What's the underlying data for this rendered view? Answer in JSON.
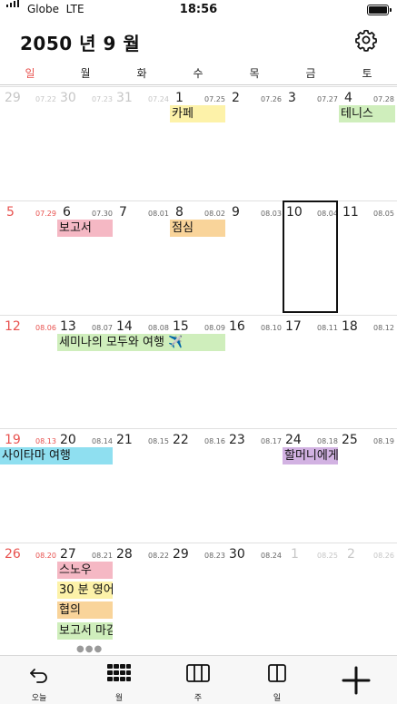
{
  "status_bar": {
    "carrier": "Globe",
    "network": "LTE",
    "time": "18:56"
  },
  "header": {
    "title": "2050 년 9 월"
  },
  "weekdays": [
    "일",
    "월",
    "화",
    "수",
    "목",
    "금",
    "토"
  ],
  "weeks": [
    {
      "days": [
        {
          "day": "29",
          "lunar": "07.22",
          "muted": true
        },
        {
          "day": "30",
          "lunar": "07.23",
          "muted": true
        },
        {
          "day": "31",
          "lunar": "07.24",
          "muted": true
        },
        {
          "day": "1",
          "lunar": "07.25"
        },
        {
          "day": "2",
          "lunar": "07.26"
        },
        {
          "day": "3",
          "lunar": "07.27"
        },
        {
          "day": "4",
          "lunar": "07.28"
        }
      ],
      "events": [
        {
          "title": "카페",
          "color": "#fdf2a9"
        },
        {
          "title": "테니스",
          "color": "#cfeebc"
        }
      ]
    },
    {
      "days": [
        {
          "day": "5",
          "lunar": "07.29"
        },
        {
          "day": "6",
          "lunar": "07.30"
        },
        {
          "day": "7",
          "lunar": "08.01"
        },
        {
          "day": "8",
          "lunar": "08.02"
        },
        {
          "day": "9",
          "lunar": "08.03"
        },
        {
          "day": "10",
          "lunar": "08.04",
          "today": true
        },
        {
          "day": "11",
          "lunar": "08.05"
        }
      ],
      "events": [
        {
          "title": "보고서",
          "color": "#f5b8c4"
        },
        {
          "title": "점심",
          "color": "#f9d49a"
        }
      ]
    },
    {
      "days": [
        {
          "day": "12",
          "lunar": "08.06"
        },
        {
          "day": "13",
          "lunar": "08.07"
        },
        {
          "day": "14",
          "lunar": "08.08"
        },
        {
          "day": "15",
          "lunar": "08.09"
        },
        {
          "day": "16",
          "lunar": "08.10"
        },
        {
          "day": "17",
          "lunar": "08.11"
        },
        {
          "day": "18",
          "lunar": "08.12"
        }
      ],
      "events": [
        {
          "title": "세미나의 모두와 여행 ✈️",
          "color": "#cfeebc"
        }
      ]
    },
    {
      "days": [
        {
          "day": "19",
          "lunar": "08.13"
        },
        {
          "day": "20",
          "lunar": "08.14"
        },
        {
          "day": "21",
          "lunar": "08.15"
        },
        {
          "day": "22",
          "lunar": "08.16"
        },
        {
          "day": "23",
          "lunar": "08.17"
        },
        {
          "day": "24",
          "lunar": "08.18"
        },
        {
          "day": "25",
          "lunar": "08.19"
        }
      ],
      "events": [
        {
          "title": "사이타마 여행",
          "color": "#8fdff0"
        },
        {
          "title": "할머니에게",
          "color": "#d2b2e2"
        }
      ]
    },
    {
      "days": [
        {
          "day": "26",
          "lunar": "08.20"
        },
        {
          "day": "27",
          "lunar": "08.21"
        },
        {
          "day": "28",
          "lunar": "08.22"
        },
        {
          "day": "29",
          "lunar": "08.23"
        },
        {
          "day": "30",
          "lunar": "08.24"
        },
        {
          "day": "1",
          "lunar": "08.25",
          "muted": true
        },
        {
          "day": "2",
          "lunar": "08.26",
          "muted": true
        }
      ],
      "events": [
        {
          "title": "스노우",
          "color": "#f5b8c4"
        },
        {
          "title": "30 분 영어",
          "color": "#fdf2a9"
        },
        {
          "title": "협의",
          "color": "#f9d49a"
        },
        {
          "title": "보고서 마감",
          "color": "#cfeebc"
        }
      ],
      "more": "●●●"
    }
  ],
  "tabbar": [
    {
      "label": "오늘",
      "icon": "undo-arrow-icon"
    },
    {
      "label": "월",
      "icon": "month-grid-icon"
    },
    {
      "label": "주",
      "icon": "week-columns-icon"
    },
    {
      "label": "일",
      "icon": "day-columns-icon"
    },
    {
      "label": "",
      "icon": "plus-icon"
    }
  ]
}
